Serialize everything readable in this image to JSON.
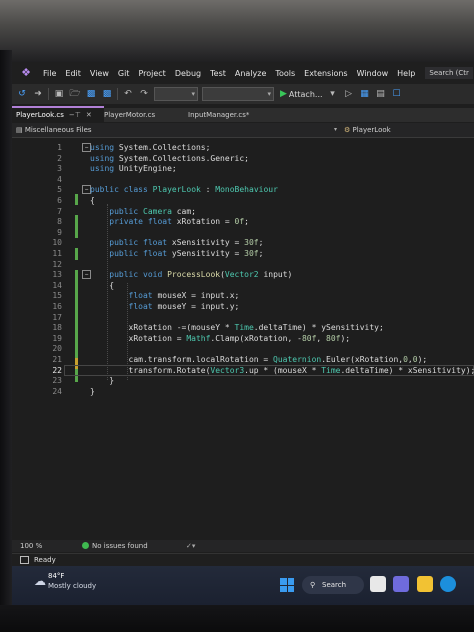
{
  "menu": {
    "items": [
      "File",
      "Edit",
      "View",
      "Git",
      "Project",
      "Debug",
      "Test",
      "Analyze",
      "Tools",
      "Extensions",
      "Window",
      "Help"
    ],
    "search": "Search (Ctr"
  },
  "toolbar": {
    "attach_label": "Attach..."
  },
  "tabs": [
    {
      "label": "PlayerLook.cs",
      "active": true
    },
    {
      "label": "PlayerMotor.cs",
      "active": false
    },
    {
      "label": "InputManager.cs*",
      "active": false
    }
  ],
  "navbar": {
    "project": "Miscellaneous Files",
    "member": "PlayerLook"
  },
  "editor": {
    "current_line": "22",
    "lines": [
      {
        "n": "1",
        "code": "using System.Collections;"
      },
      {
        "n": "2",
        "code": "using System.Collections.Generic;"
      },
      {
        "n": "3",
        "code": "using UnityEngine;"
      },
      {
        "n": "4",
        "code": ""
      },
      {
        "n": "5",
        "code": "public class PlayerLook : MonoBehaviour"
      },
      {
        "n": "6",
        "code": "{"
      },
      {
        "n": "7",
        "code": "    public Camera cam;"
      },
      {
        "n": "8",
        "code": "    private float xRotation = 0f;"
      },
      {
        "n": "9",
        "code": ""
      },
      {
        "n": "10",
        "code": "    public float xSensitivity = 30f;"
      },
      {
        "n": "11",
        "code": "    public float ySensitivity = 30f;"
      },
      {
        "n": "12",
        "code": ""
      },
      {
        "n": "13",
        "code": "    public void ProcessLook(Vector2 input)"
      },
      {
        "n": "14",
        "code": "    {"
      },
      {
        "n": "15",
        "code": "        float mouseX = input.x;"
      },
      {
        "n": "16",
        "code": "        float mouseY = input.y;"
      },
      {
        "n": "17",
        "code": ""
      },
      {
        "n": "18",
        "code": "        xRotation -=(mouseY * Time.deltaTime) * ySensitivity;"
      },
      {
        "n": "19",
        "code": "        xRotation = Mathf.Clamp(xRotation, -80f, 80f);"
      },
      {
        "n": "20",
        "code": ""
      },
      {
        "n": "21",
        "code": "        cam.transform.localRotation = Quaternion.Euler(xRotation,0,0);"
      },
      {
        "n": "22",
        "code": "        transform.Rotate(Vector3.up * (mouseX * Time.deltaTime) * xSensitivity);"
      },
      {
        "n": "23",
        "code": "    }"
      },
      {
        "n": "24",
        "code": "}"
      }
    ]
  },
  "status": {
    "zoom": "100 %",
    "issues": "No issues found",
    "ready": "Ready"
  },
  "taskbar": {
    "temperature": "84°F",
    "condition": "Mostly cloudy",
    "search_label": "Search"
  },
  "colors": {
    "keyword": "#569cd6",
    "type": "#4ec9b0",
    "number": "#b5cea8",
    "method": "#dcdcaa",
    "change_bar": "#57a64a"
  }
}
